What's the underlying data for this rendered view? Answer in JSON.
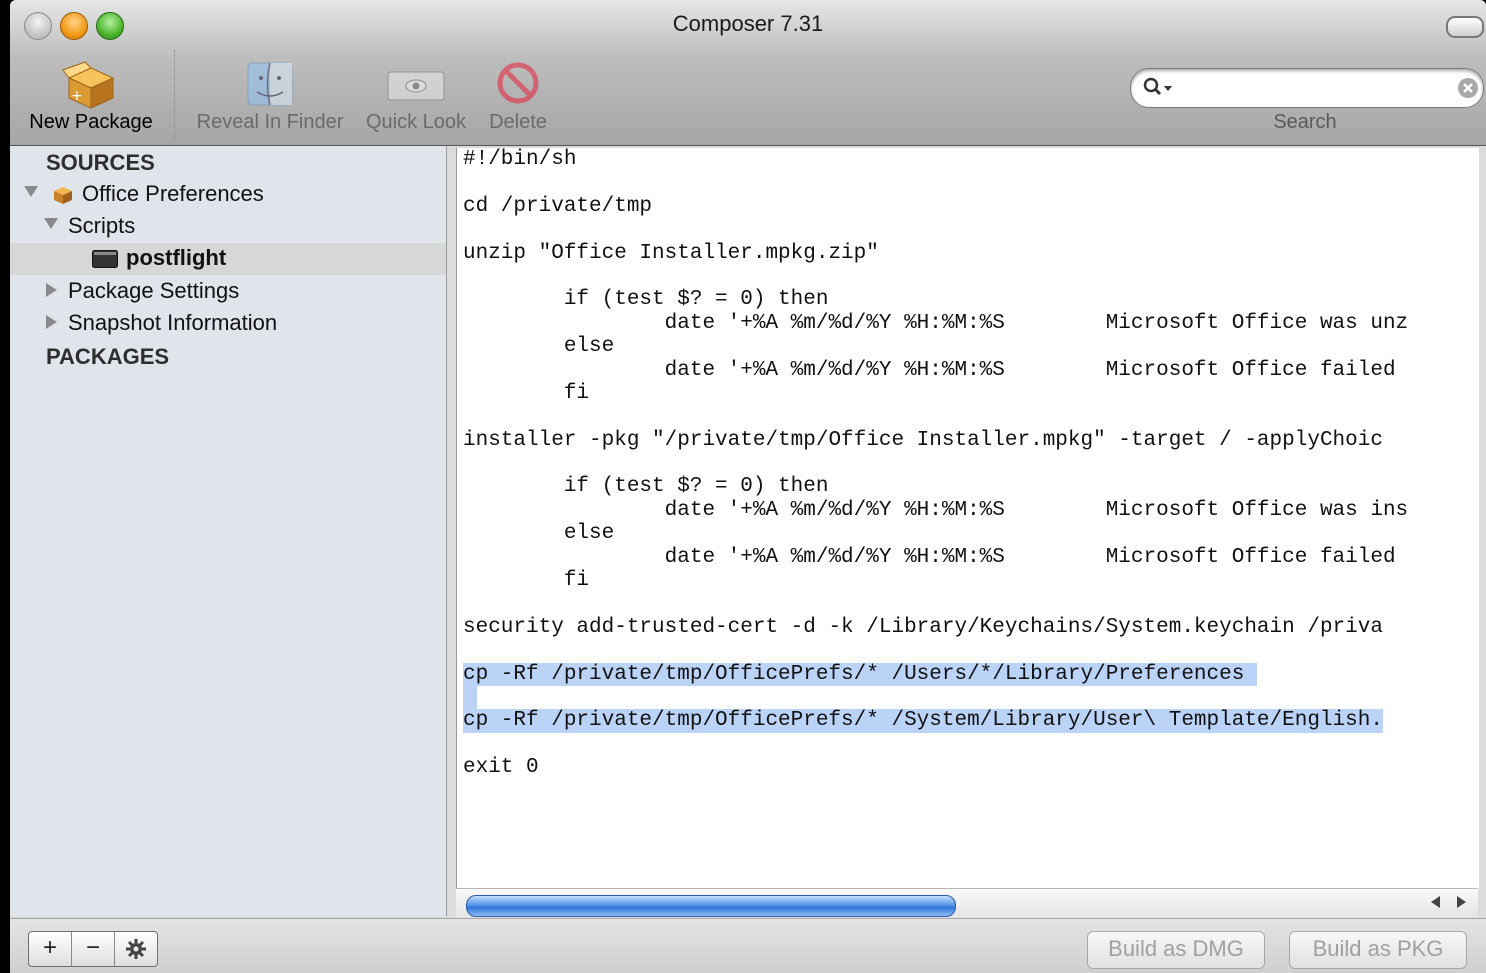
{
  "window": {
    "title": "Composer 7.31"
  },
  "toolbar": {
    "new_package": "New Package",
    "reveal_in_finder": "Reveal In Finder",
    "quick_look": "Quick Look",
    "delete": "Delete",
    "search_label": "Search",
    "search_value": ""
  },
  "sidebar": {
    "sources_heading": "SOURCES",
    "packages_heading": "PACKAGES",
    "items": [
      {
        "label": "Office Preferences",
        "icon": "package-icon",
        "expanded": true
      },
      {
        "label": "Scripts",
        "expanded": true
      },
      {
        "label": "postflight",
        "icon": "script-icon",
        "selected": true
      },
      {
        "label": "Package Settings",
        "expanded": false
      },
      {
        "label": "Snapshot Information",
        "expanded": false
      }
    ]
  },
  "editor": {
    "lines": [
      "#!/bin/sh",
      "",
      "cd /private/tmp",
      "",
      "unzip \"Office Installer.mpkg.zip\"",
      "",
      "        if (test $? = 0) then",
      "                date '+%A %m/%d/%Y %H:%M:%S        Microsoft Office was unz",
      "        else",
      "                date '+%A %m/%d/%Y %H:%M:%S        Microsoft Office failed ",
      "        fi",
      "",
      "installer -pkg \"/private/tmp/Office Installer.mpkg\" -target / -applyChoic",
      "",
      "        if (test $? = 0) then",
      "                date '+%A %m/%d/%Y %H:%M:%S        Microsoft Office was ins",
      "        else",
      "                date '+%A %m/%d/%Y %H:%M:%S        Microsoft Office failed ",
      "        fi",
      "",
      "security add-trusted-cert -d -k /Library/Keychains/System.keychain /priva",
      "",
      "cp -Rf /private/tmp/OfficePrefs/* /Users/*/Library/Preferences ",
      "",
      "cp -Rf /private/tmp/OfficePrefs/* /System/Library/User\\ Template/English.",
      "",
      "exit 0"
    ],
    "highlighted_lines": [
      22,
      23,
      24
    ],
    "highlight_color": "#bcd3f8"
  },
  "bottom": {
    "add": "+",
    "remove": "−",
    "gear_icon": "gear-icon",
    "build_dmg": "Build as DMG",
    "build_pkg": "Build as PKG"
  }
}
